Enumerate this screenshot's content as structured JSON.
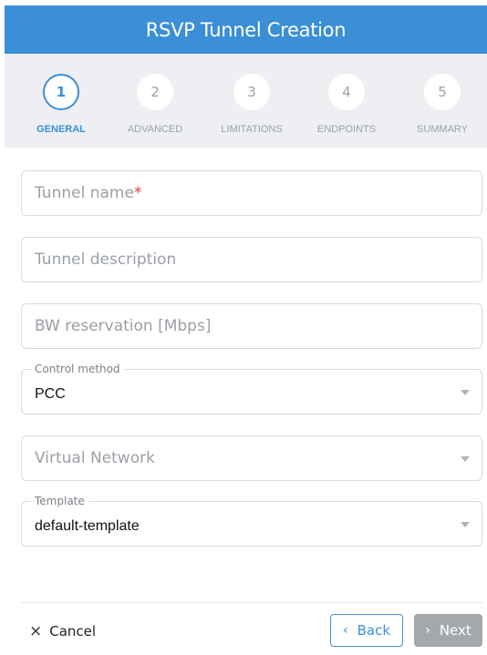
{
  "dialog": {
    "title": "RSVP Tunnel Creation"
  },
  "steps": [
    {
      "number": "1",
      "label": "GENERAL",
      "active": true
    },
    {
      "number": "2",
      "label": "ADVANCED",
      "active": false
    },
    {
      "number": "3",
      "label": "LIMITATIONS",
      "active": false
    },
    {
      "number": "4",
      "label": "ENDPOINTS",
      "active": false
    },
    {
      "number": "5",
      "label": "SUMMARY",
      "active": false
    }
  ],
  "form": {
    "tunnel_name": {
      "placeholder": "Tunnel name",
      "required_mark": "*"
    },
    "tunnel_description": {
      "placeholder": "Tunnel description"
    },
    "bw_reservation": {
      "placeholder": "BW reservation [Mbps]"
    },
    "control_method": {
      "label": "Control method",
      "value": "PCC"
    },
    "virtual_network": {
      "placeholder": "Virtual Network"
    },
    "template": {
      "label": "Template",
      "value": "default-template"
    }
  },
  "footer": {
    "cancel_icon": "×",
    "cancel_label": "Cancel",
    "back_icon": "‹",
    "back_label": "Back",
    "next_icon": "›",
    "next_label": "Next"
  },
  "colors": {
    "accent": "#3a8fd6",
    "stepper_bg": "#edeff2",
    "disabled_button": "#a3a8ad",
    "required": "#e53935"
  }
}
